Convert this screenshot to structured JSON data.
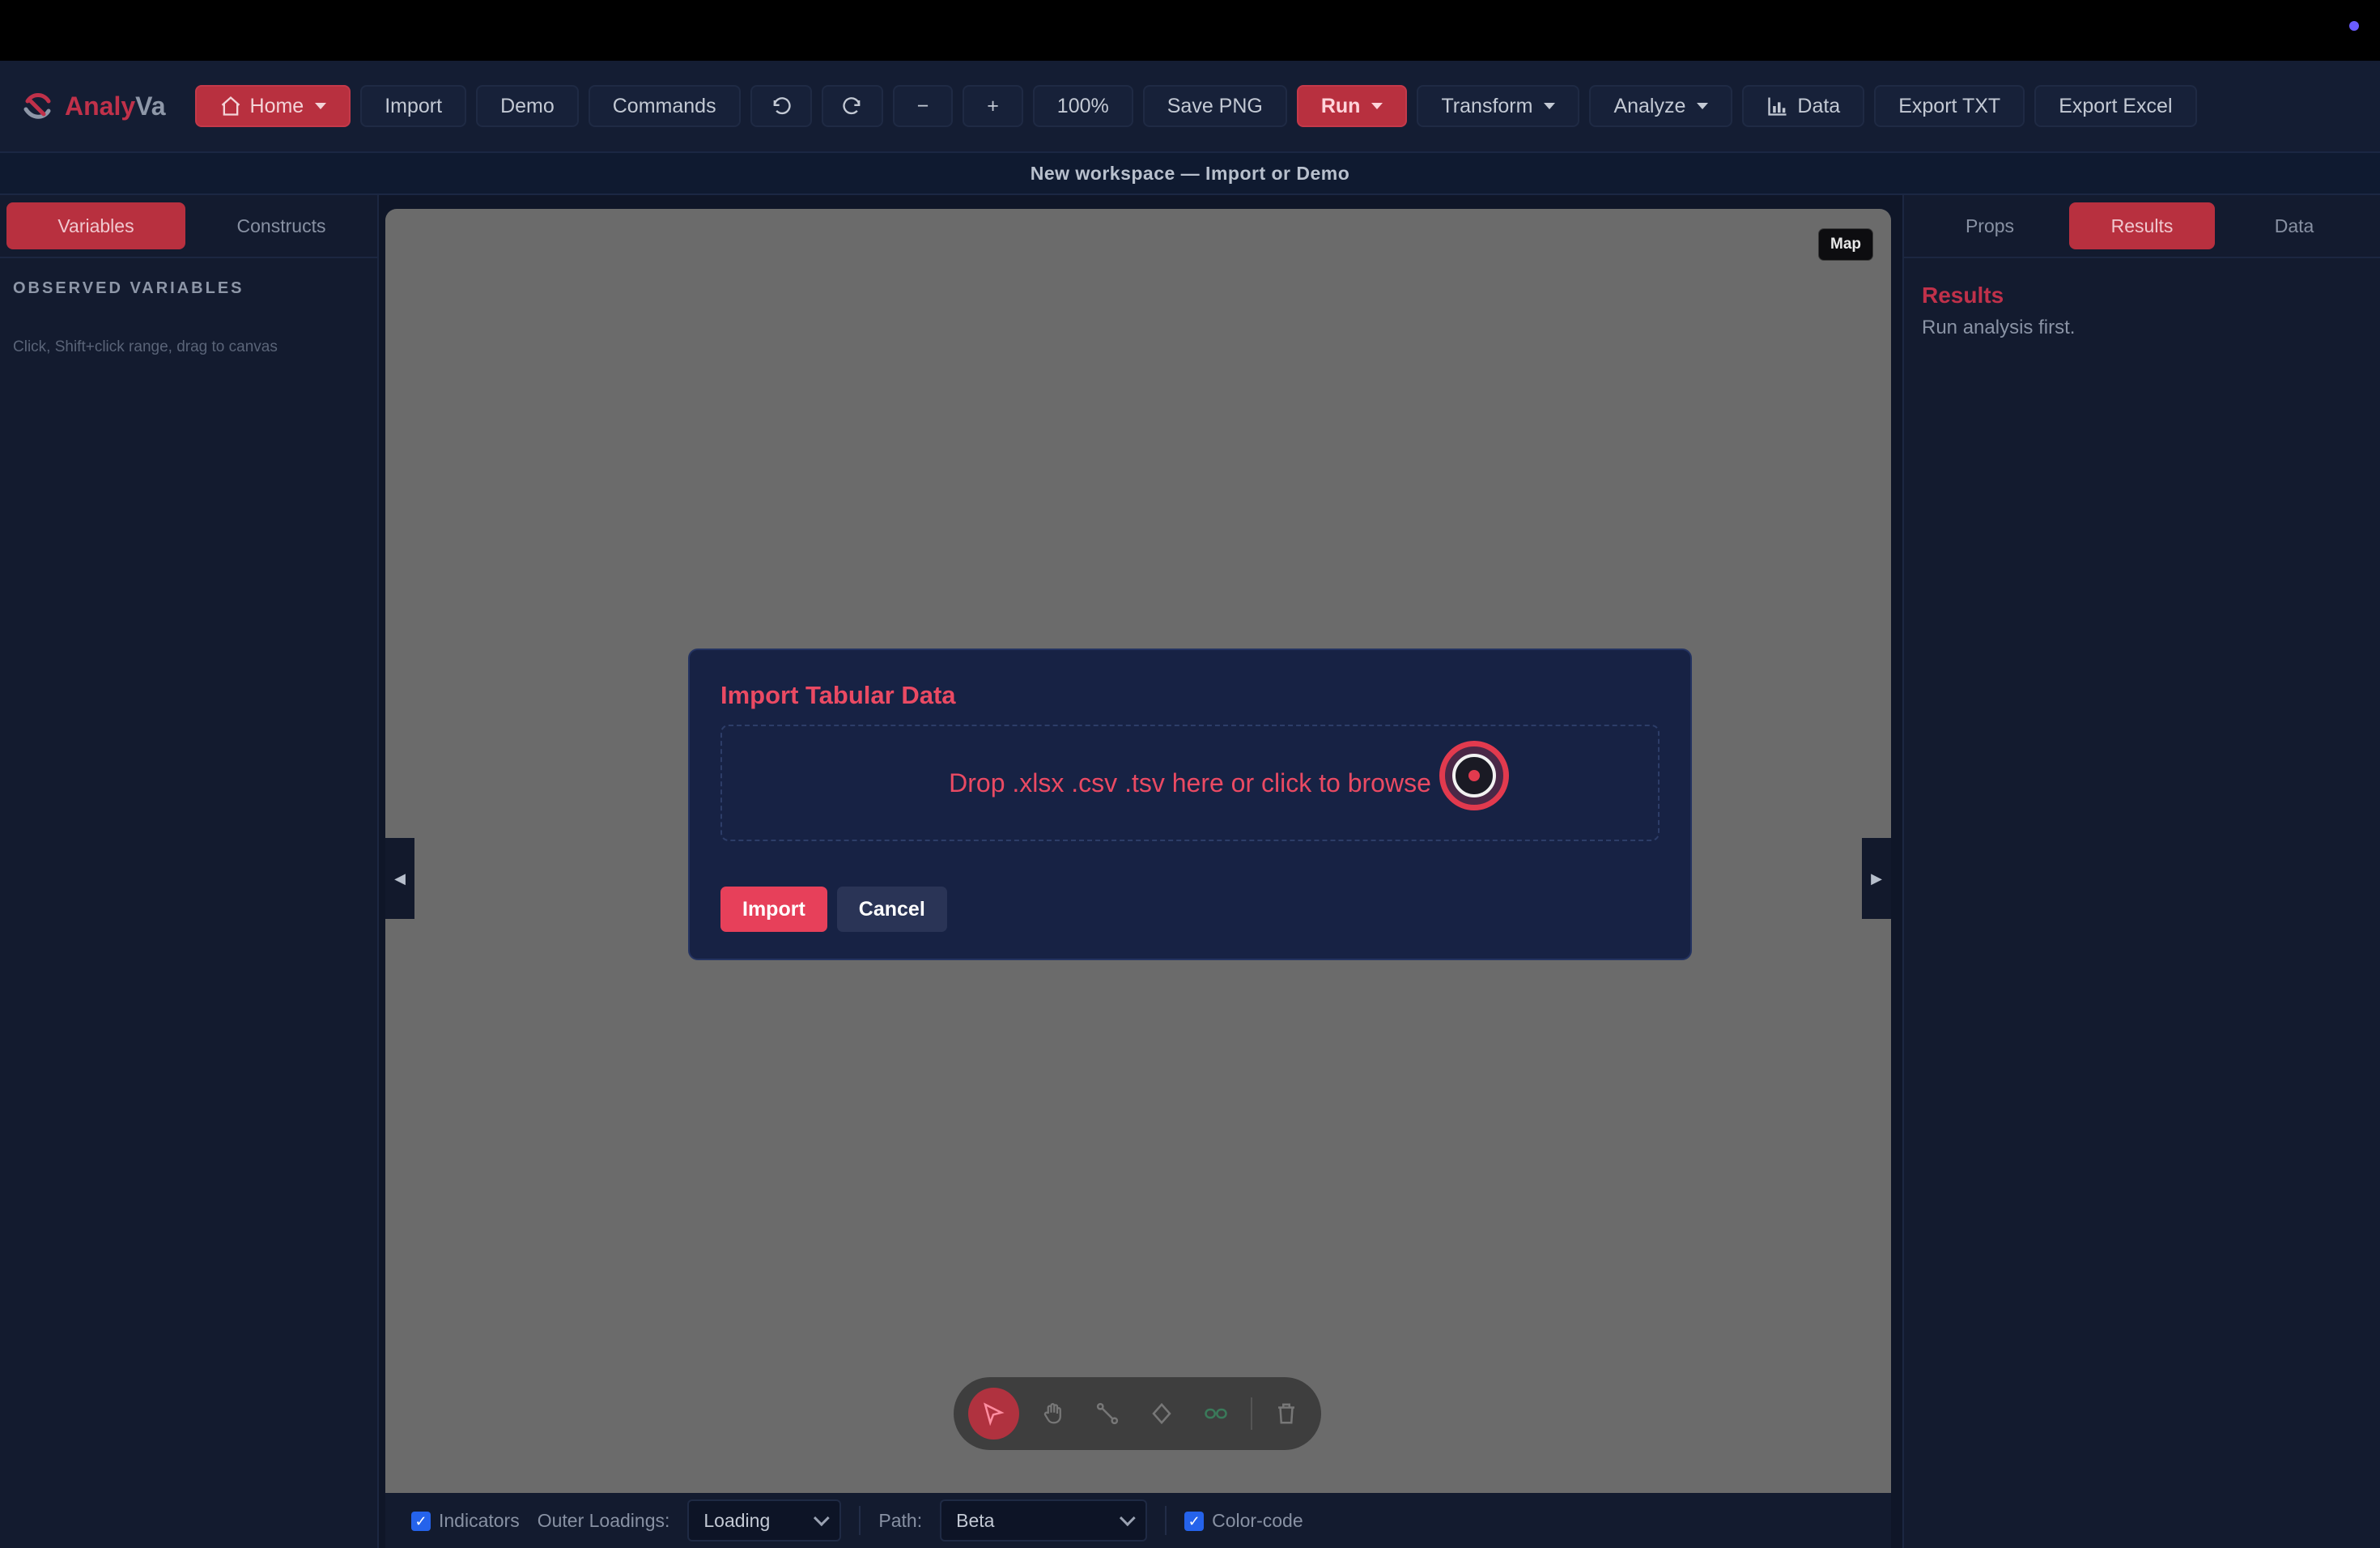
{
  "app": {
    "name_part1": "Analy",
    "name_part2": "Va"
  },
  "toolbar": {
    "home": "Home",
    "import": "Import",
    "demo": "Demo",
    "commands": "Commands",
    "zoom_out": "−",
    "zoom_in": "+",
    "zoom_level": "100%",
    "save_png": "Save PNG",
    "run": "Run",
    "transform": "Transform",
    "analyze": "Analyze",
    "data": "Data",
    "export_txt": "Export TXT",
    "export_excel": "Export Excel"
  },
  "banner": "New workspace — Import or Demo",
  "left_panel": {
    "tabs": [
      "Variables",
      "Constructs"
    ],
    "active_tab": "Variables",
    "section_title": "OBSERVED VARIABLES",
    "hint": "Click, Shift+click range, drag to canvas"
  },
  "canvas": {
    "map_label": "Map",
    "left_handle": "◀",
    "right_handle": "▶"
  },
  "right_panel": {
    "tabs": [
      "Props",
      "Results",
      "Data"
    ],
    "active_tab": "Results",
    "results_title": "Results",
    "results_text": "Run analysis first."
  },
  "modal": {
    "title": "Import Tabular Data",
    "drop_text": "Drop .xlsx .csv .tsv here or click to browse",
    "import_label": "Import",
    "cancel_label": "Cancel"
  },
  "bottom_bar": {
    "indicators_label": "Indicators",
    "indicators_checked": true,
    "outer_loadings_label": "Outer Loadings:",
    "outer_loadings_value": "Loading",
    "path_label": "Path:",
    "path_value": "Beta",
    "color_code_label": "Color-code",
    "color_code_checked": true
  },
  "tools": [
    "select-icon",
    "pan-hand-icon",
    "connect-icon",
    "node-icon",
    "link-icon",
    "trash-icon"
  ],
  "colors": {
    "accent": "#b8303f",
    "modal_title": "#ea4a63",
    "import_button": "#e7405a"
  }
}
